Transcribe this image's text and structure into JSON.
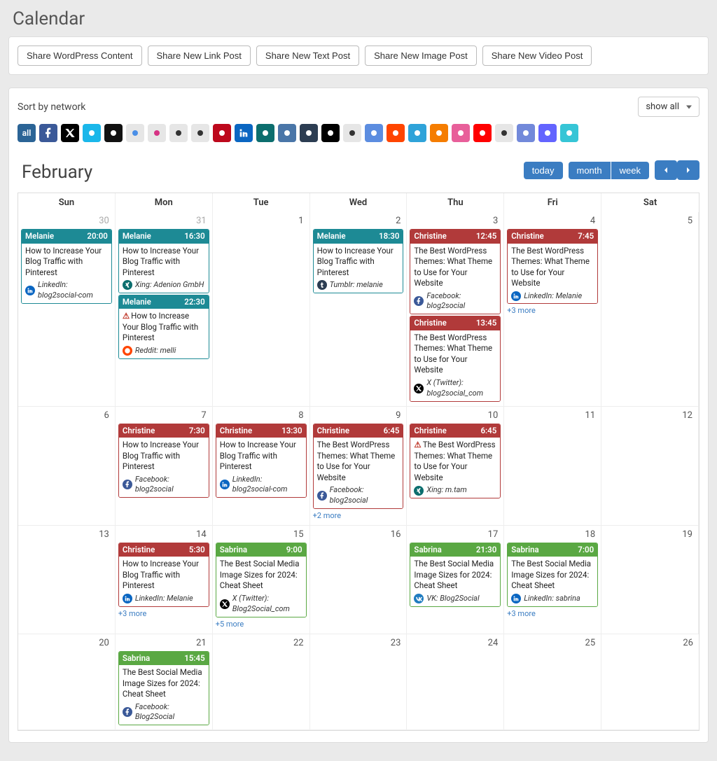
{
  "page_title": "Calendar",
  "toolbar": {
    "share_wp": "Share WordPress Content",
    "share_link": "Share New Link Post",
    "share_text": "Share New Text Post",
    "share_image": "Share New Image Post",
    "share_video": "Share New Video Post"
  },
  "filter": {
    "sort_label": "Sort by network",
    "show_all": "show all",
    "all_label": "all"
  },
  "month_label": "February",
  "controls": {
    "today": "today",
    "month": "month",
    "week": "week"
  },
  "dayheaders": [
    "Sun",
    "Mon",
    "Tue",
    "Wed",
    "Thu",
    "Fri",
    "Sat"
  ],
  "cells": [
    {
      "num": "30",
      "muted": true,
      "events": [
        {
          "color": "melanie",
          "author": "Melanie",
          "time": "20:00",
          "title": "How to Increase Your Blog Traffic with Pinterest",
          "net": "in",
          "net_label": "LinkedIn: blog2social-com"
        }
      ]
    },
    {
      "num": "31",
      "muted": true,
      "events": [
        {
          "color": "melanie",
          "author": "Melanie",
          "time": "16:30",
          "title": "How to Increase Your Blog Traffic with Pinterest",
          "net": "xi",
          "net_label": "Xing: Adenion GmbH"
        },
        {
          "color": "melanie",
          "author": "Melanie",
          "time": "22:30",
          "warn": true,
          "title": "How to Increase Your Blog Traffic with Pinterest",
          "net": "rd",
          "net_label": "Reddit: melli"
        }
      ]
    },
    {
      "num": "1",
      "events": []
    },
    {
      "num": "2",
      "events": [
        {
          "color": "melanie",
          "author": "Melanie",
          "time": "18:30",
          "title": "How to Increase Your Blog Traffic with Pinterest",
          "net": "tum",
          "net_label": "Tumblr: melanie"
        }
      ]
    },
    {
      "num": "3",
      "events": [
        {
          "color": "christine",
          "author": "Christine",
          "time": "12:45",
          "title": "The Best WordPress Themes: What Theme to Use for Your Website",
          "net": "fb",
          "net_label": "Facebook: blog2social"
        },
        {
          "color": "christine",
          "author": "Christine",
          "time": "13:45",
          "title": "The Best WordPress Themes: What Theme to Use for Your Website",
          "net": "tw",
          "net_label": "X (Twitter): blog2social_com"
        }
      ]
    },
    {
      "num": "4",
      "events": [
        {
          "color": "christine",
          "author": "Christine",
          "time": "7:45",
          "title": "The Best WordPress Themes: What Theme to Use for Your Website",
          "net": "in",
          "net_label": "LinkedIn: Melanie"
        }
      ],
      "more": "+3 more"
    },
    {
      "num": "5",
      "events": []
    },
    {
      "num": "6",
      "events": []
    },
    {
      "num": "7",
      "events": [
        {
          "color": "christine",
          "author": "Christine",
          "time": "7:30",
          "title": "How to Increase Your Blog Traffic with Pinterest",
          "net": "fb",
          "net_label": "Facebook: blog2social"
        }
      ]
    },
    {
      "num": "8",
      "events": [
        {
          "color": "christine",
          "author": "Christine",
          "time": "13:30",
          "title": "How to Increase Your Blog Traffic with Pinterest",
          "net": "in",
          "net_label": "LinkedIn: blog2social-com"
        }
      ]
    },
    {
      "num": "9",
      "events": [
        {
          "color": "christine",
          "author": "Christine",
          "time": "6:45",
          "title": "The Best WordPress Themes: What Theme to Use for Your Website",
          "net": "fb",
          "net_label": "Facebook: blog2social"
        }
      ],
      "more": "+2 more"
    },
    {
      "num": "10",
      "events": [
        {
          "color": "christine",
          "author": "Christine",
          "time": "6:45",
          "warn": true,
          "title": "The Best WordPress Themes: What Theme to Use for Your Website",
          "net": "xi",
          "net_label": "Xing: m.tam"
        }
      ]
    },
    {
      "num": "11",
      "events": []
    },
    {
      "num": "12",
      "events": []
    },
    {
      "num": "13",
      "events": []
    },
    {
      "num": "14",
      "events": [
        {
          "color": "christine",
          "author": "Christine",
          "time": "5:30",
          "title": "How to Increase Your Blog Traffic with Pinterest",
          "net": "in",
          "net_label": "LinkedIn: Melanie"
        }
      ],
      "more": "+3 more"
    },
    {
      "num": "15",
      "events": [
        {
          "color": "sabrina",
          "author": "Sabrina",
          "time": "9:00",
          "title": "The Best Social Media Image Sizes for 2024: Cheat Sheet",
          "net": "tw",
          "net_label": "X (Twitter): Blog2Social_com"
        }
      ],
      "more": "+5 more"
    },
    {
      "num": "16",
      "events": []
    },
    {
      "num": "17",
      "events": [
        {
          "color": "sabrina",
          "author": "Sabrina",
          "time": "21:30",
          "title": "The Best Social Media Image Sizes for 2024: Cheat Sheet",
          "net": "vk",
          "net_label": "VK: Blog2Social"
        }
      ]
    },
    {
      "num": "18",
      "events": [
        {
          "color": "sabrina",
          "author": "Sabrina",
          "time": "7:00",
          "title": "The Best Social Media Image Sizes for 2024: Cheat Sheet",
          "net": "in",
          "net_label": "LinkedIn: sabrina"
        }
      ],
      "more": "+3 more"
    },
    {
      "num": "19",
      "events": []
    },
    {
      "num": "20",
      "events": []
    },
    {
      "num": "21",
      "events": [
        {
          "color": "sabrina",
          "author": "Sabrina",
          "time": "15:45",
          "title": "The Best Social Media Image Sizes for 2024: Cheat Sheet",
          "net": "fb",
          "net_label": "Facebook: Blog2Social"
        }
      ]
    },
    {
      "num": "22",
      "events": []
    },
    {
      "num": "23",
      "events": []
    },
    {
      "num": "24",
      "events": []
    },
    {
      "num": "25",
      "events": []
    },
    {
      "num": "26",
      "events": []
    }
  ],
  "networks": [
    {
      "name": "all",
      "label": "all",
      "type": "all"
    },
    {
      "name": "facebook",
      "bg": "#3b5998",
      "svg": "fb"
    },
    {
      "name": "x-twitter",
      "bg": "#000",
      "svg": "tw"
    },
    {
      "name": "vimeo",
      "bg": "#1ab7ea",
      "svg": "dot"
    },
    {
      "name": "tiktok",
      "bg": "#111",
      "svg": "dot"
    },
    {
      "name": "butterfly",
      "bg": "#e6e6e6",
      "svg": "dot",
      "fg": "blue"
    },
    {
      "name": "instagram",
      "bg": "#e6e6e6",
      "svg": "dot",
      "fg": "pink"
    },
    {
      "name": "threads",
      "bg": "#e6e6e6",
      "svg": "dot",
      "fg": "black"
    },
    {
      "name": "app1",
      "bg": "#e6e6e6",
      "svg": "dot"
    },
    {
      "name": "pinterest",
      "bg": "#bd081c",
      "svg": "dot"
    },
    {
      "name": "linkedin",
      "bg": "#0a66c2",
      "svg": "in"
    },
    {
      "name": "xing",
      "bg": "#0c6e6e",
      "svg": "dot"
    },
    {
      "name": "vk",
      "bg": "#4a76a8",
      "svg": "dot"
    },
    {
      "name": "tumblr",
      "bg": "#2c3d52",
      "svg": "dot"
    },
    {
      "name": "medium",
      "bg": "#000",
      "svg": "dot"
    },
    {
      "name": "flickr",
      "bg": "#e6e6e6",
      "svg": "dot"
    },
    {
      "name": "diaspora",
      "bg": "#5c8de0",
      "svg": "dot"
    },
    {
      "name": "reddit",
      "bg": "#ff4500",
      "svg": "dot"
    },
    {
      "name": "telegram",
      "bg": "#2fa3d9",
      "svg": "dot"
    },
    {
      "name": "blogger",
      "bg": "#f57d00",
      "svg": "dot"
    },
    {
      "name": "ravelry",
      "bg": "#e85f9a",
      "svg": "dot"
    },
    {
      "name": "youtube",
      "bg": "#ff0000",
      "svg": "dot"
    },
    {
      "name": "instapaper",
      "bg": "#e6e6e6",
      "svg": "dot",
      "fg": "black"
    },
    {
      "name": "discord",
      "bg": "#7289da",
      "svg": "dot"
    },
    {
      "name": "mastodon",
      "bg": "#6364ff",
      "svg": "dot"
    },
    {
      "name": "app2",
      "bg": "#36c5d6",
      "svg": "dot"
    }
  ]
}
